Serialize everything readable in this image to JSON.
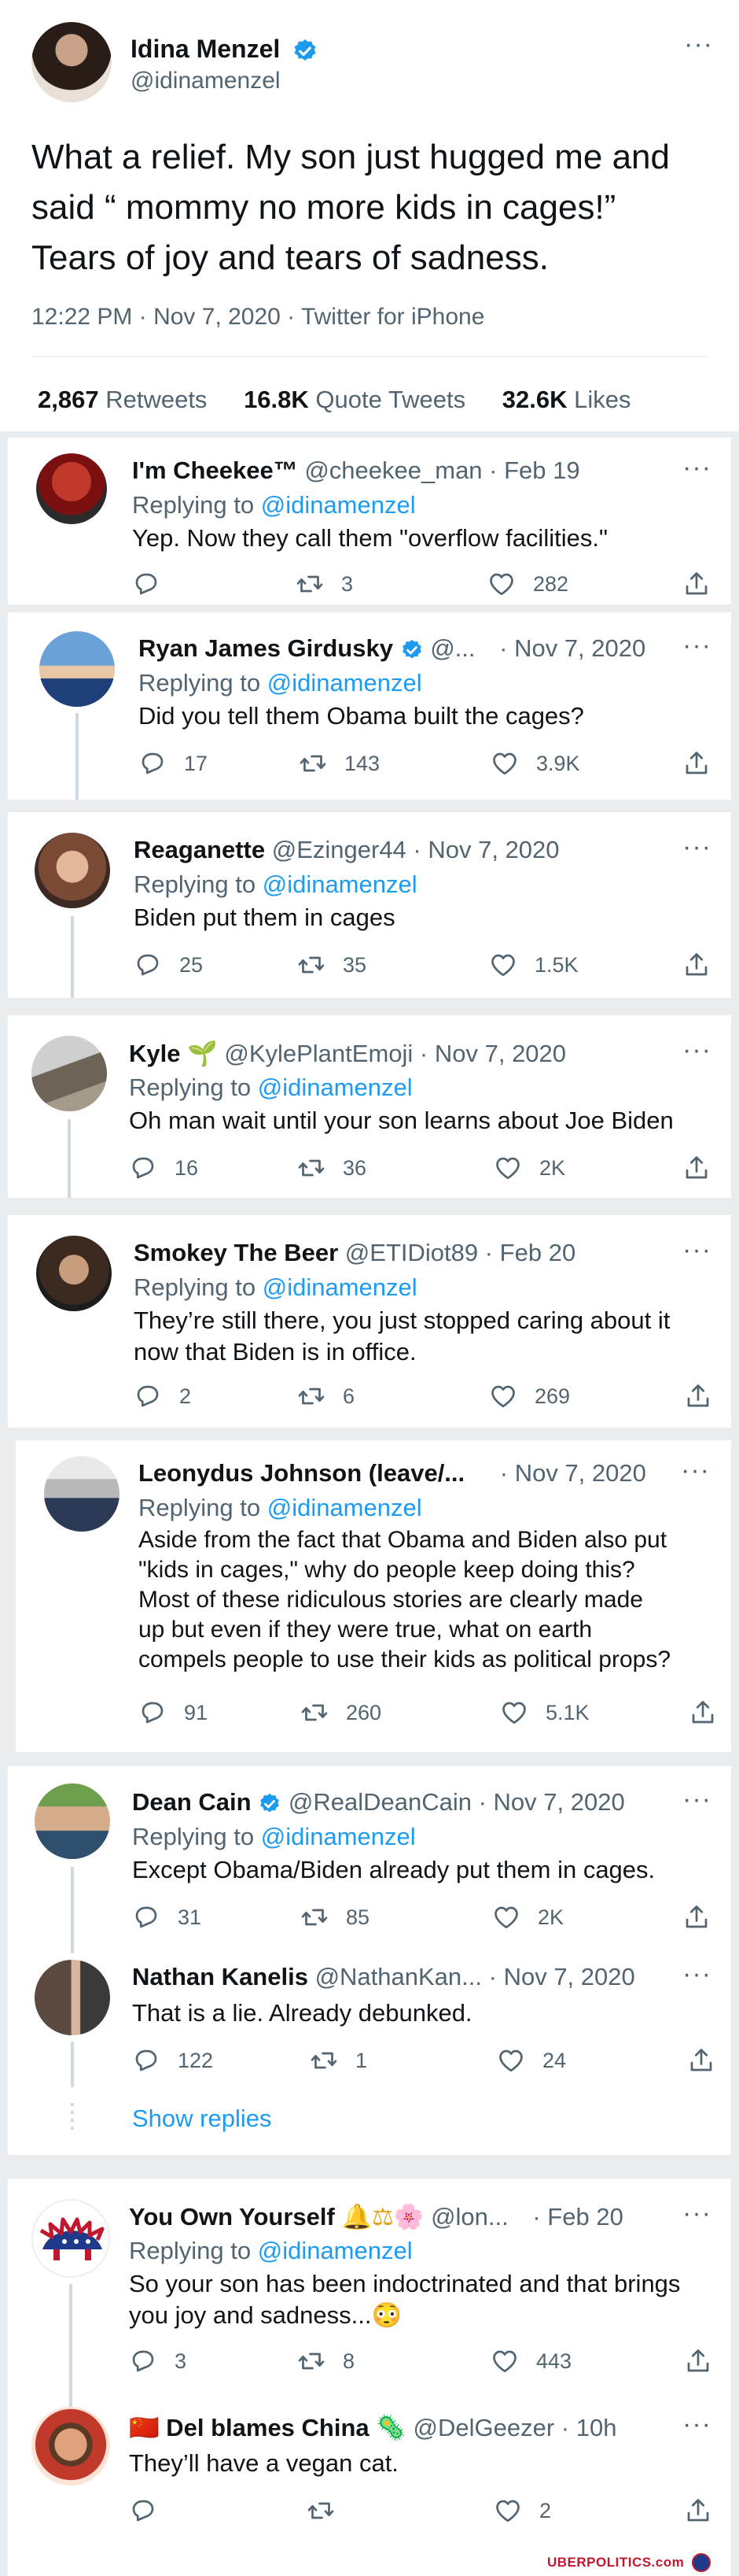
{
  "main": {
    "name": "Idina Menzel",
    "handle": "@idinamenzel",
    "text_lines": [
      "What a relief.  My son just hugged me and",
      "said “ mommy no more kids in cages!”",
      "Tears of joy and tears of sadness."
    ],
    "meta": "12:22 PM · Nov 7, 2020 · Twitter for iPhone",
    "retweets": "2,867",
    "retweets_label": "Retweets",
    "quotes": "16.8K",
    "quotes_label": "Quote Tweets",
    "likes": "32.6K",
    "likes_label": "Likes"
  },
  "replying_prefix": "Replying to",
  "replying_handle": "@idinamenzel",
  "show_replies": "Show replies",
  "watermark": "UBERPOLITICS.com",
  "replies": [
    {
      "name": "I'm Cheekee™",
      "handle": "@cheekee_man",
      "date": "· Feb 19",
      "text": "Yep. Now they call them \"overflow facilities.\"",
      "comments": "",
      "retweets": "3",
      "likes": "282"
    },
    {
      "name": "Ryan James Girdusky",
      "handle": "@...",
      "date": "· Nov 7, 2020",
      "text": "Did you tell them Obama built the cages?",
      "comments": "17",
      "retweets": "143",
      "likes": "3.9K"
    },
    {
      "name": "Reaganette",
      "handle": "@Ezinger44",
      "date": "· Nov 7, 2020",
      "text": "Biden put them in cages",
      "comments": "25",
      "retweets": "35",
      "likes": "1.5K"
    },
    {
      "name": "Kyle",
      "emoji": "🌱",
      "handle": "@KylePlantEmoji",
      "date": "· Nov 7, 2020",
      "text": "Oh man wait until your son learns about Joe Biden",
      "comments": "16",
      "retweets": "36",
      "likes": "2K"
    },
    {
      "name": "Smokey The Beer",
      "handle": "@ETIDiot89",
      "date": "· Feb 20",
      "text_lines": [
        "They’re still there, you just stopped caring about it",
        "now that Biden is in office."
      ],
      "comments": "2",
      "retweets": "6",
      "likes": "269"
    },
    {
      "name": "Leonydus Johnson (leave/...",
      "handle": "",
      "date": "· Nov 7, 2020",
      "text_lines": [
        "Aside from the fact that Obama and Biden also put",
        "\"kids in cages,\" why do people keep doing this?",
        "Most of these ridiculous stories are clearly made",
        "up but even if they were true, what on earth",
        "compels people to use their kids as political props?"
      ],
      "comments": "91",
      "retweets": "260",
      "likes": "5.1K"
    },
    {
      "name": "Dean Cain",
      "handle": "@RealDeanCain",
      "date": "· Nov 7, 2020",
      "text": "Except Obama/Biden already put them in cages.",
      "comments": "31",
      "retweets": "85",
      "likes": "2K"
    },
    {
      "name": "Nathan Kanelis",
      "handle": "@NathanKan...",
      "date": "· Nov 7, 2020",
      "text": "That is a lie. Already debunked.",
      "comments": "122",
      "retweets": "1",
      "likes": "24"
    },
    {
      "name": "You Own Yourself",
      "emoji": "🔔⚖🌸",
      "handle": "@lon...",
      "date": "· Feb 20",
      "text_lines": [
        "So your son has been indoctrinated and that brings",
        "you joy and sadness...😳"
      ],
      "comments": "3",
      "retweets": "8",
      "likes": "443"
    },
    {
      "name": "Del blames China",
      "emoji_before": "🇨🇳",
      "emoji": "🦠",
      "handle": "@DelGeezer",
      "date": "· 10h",
      "text": "They’ll have a vegan cat.",
      "comments": "",
      "retweets": "",
      "likes": "2"
    }
  ],
  "colors": {
    "blue": "#1d9bf0",
    "gray": "#536471",
    "border": "#cfd9de",
    "background": "#e9ecef"
  }
}
